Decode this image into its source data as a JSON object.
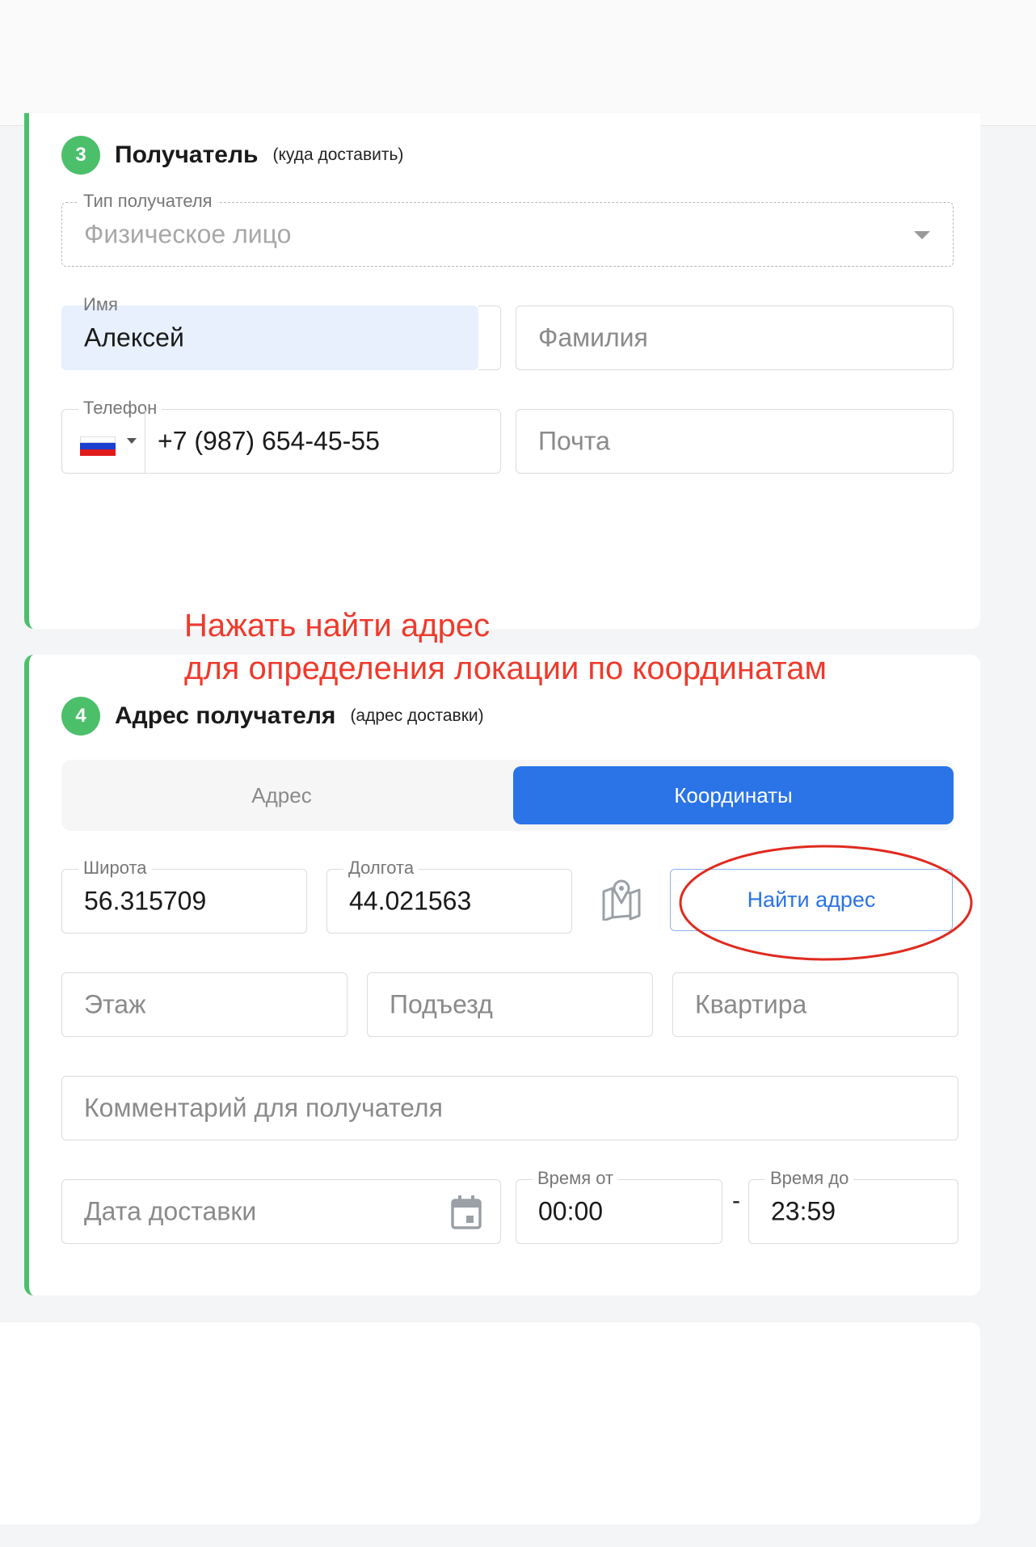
{
  "recipient": {
    "step": "3",
    "title": "Получатель",
    "subtitle": "(куда доставить)",
    "type_label": "Тип получателя",
    "type_value": "Физическое лицо",
    "first_name_label": "Имя",
    "first_name_value": "Алексей",
    "last_name_placeholder": "Фамилия",
    "phone_label": "Телефон",
    "phone_value": "+7 (987) 654-45-55",
    "email_placeholder": "Почта"
  },
  "annotation": {
    "line1": "Нажать найти адрес",
    "line2": "для определения локации по координатам"
  },
  "address": {
    "step": "4",
    "title": "Адрес получателя",
    "subtitle": "(адрес доставки)",
    "tabs": [
      {
        "label": "Адрес",
        "active": false
      },
      {
        "label": "Координаты",
        "active": true
      }
    ],
    "latitude_label": "Широта",
    "latitude_value": "56.315709",
    "longitude_label": "Долгота",
    "longitude_value": "44.021563",
    "find_button": "Найти адрес",
    "floor_placeholder": "Этаж",
    "entrance_placeholder": "Подъезд",
    "apartment_placeholder": "Квартира",
    "comment_placeholder": "Комментарий для получателя",
    "date_placeholder": "Дата доставки",
    "time_from_label": "Время от",
    "time_from_value": "00:00",
    "time_separator": "-",
    "time_to_label": "Время до",
    "time_to_value": "23:59"
  },
  "colors": {
    "accent_green": "#4cbf6b",
    "primary_blue": "#2a74e8",
    "annotation_red": "#ee3a2c"
  },
  "icons": {
    "map_pin": "map-pin-icon",
    "calendar": "calendar-icon",
    "flag": "russia-flag-icon"
  }
}
